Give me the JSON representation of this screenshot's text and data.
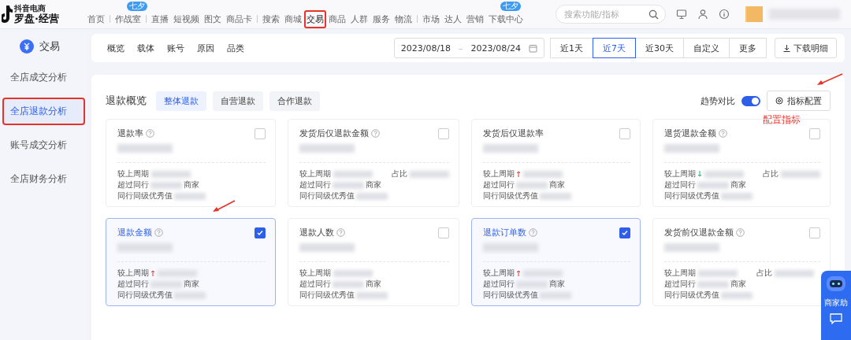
{
  "logo": {
    "small": "抖音电商",
    "main": "罗盘·经营"
  },
  "nav": [
    {
      "label": "首页",
      "selected": false,
      "sep": true
    },
    {
      "label": "作战室",
      "selected": false,
      "sep": true,
      "badge": "七夕"
    },
    {
      "label": "直播",
      "selected": false
    },
    {
      "label": "短视频",
      "selected": false
    },
    {
      "label": "图文",
      "selected": false
    },
    {
      "label": "商品卡",
      "selected": false,
      "sep": true
    },
    {
      "label": "搜索",
      "selected": false
    },
    {
      "label": "商城",
      "selected": false
    },
    {
      "label": "交易",
      "selected": true,
      "annotated": true
    },
    {
      "label": "商品",
      "selected": false
    },
    {
      "label": "人群",
      "selected": false
    },
    {
      "label": "服务",
      "selected": false
    },
    {
      "label": "物流",
      "selected": false,
      "sep": true
    },
    {
      "label": "市场",
      "selected": false
    },
    {
      "label": "达人",
      "selected": false
    },
    {
      "label": "营销",
      "selected": false
    },
    {
      "label": "下载中心",
      "selected": false,
      "badge": "七夕"
    }
  ],
  "search": {
    "placeholder": "搜索功能/指标"
  },
  "sidebar": {
    "title": "交易",
    "items": [
      {
        "label": "全店成交分析",
        "selected": false
      },
      {
        "label": "全店退款分析",
        "selected": true,
        "annotated": true
      },
      {
        "label": "账号成交分析",
        "selected": false
      },
      {
        "label": "全店财务分析",
        "selected": false
      }
    ]
  },
  "filter_tabs": [
    {
      "label": "概览"
    },
    {
      "label": "载体"
    },
    {
      "label": "账号"
    },
    {
      "label": "原因"
    },
    {
      "label": "品类"
    }
  ],
  "date_range": {
    "start": "2023/08/18",
    "separator": "–",
    "end": "2023/08/24"
  },
  "periods": [
    {
      "label": "近1天",
      "selected": false
    },
    {
      "label": "近7天",
      "selected": true
    },
    {
      "label": "近30天",
      "selected": false
    },
    {
      "label": "自定义",
      "selected": false
    },
    {
      "label": "更多",
      "selected": false
    }
  ],
  "download_button": "下载明细",
  "overview": {
    "title": "退款概览",
    "tabs": [
      {
        "label": "整体退款",
        "selected": true
      },
      {
        "label": "自营退款",
        "selected": false
      },
      {
        "label": "合作退款",
        "selected": false
      }
    ],
    "trend_compare": {
      "label": "趋势对比",
      "on": true
    },
    "config_button": "指标配置",
    "annotation": "配置指标"
  },
  "metrics": [
    {
      "name": "退款率",
      "help": true,
      "checked": false,
      "compare": "较上周期",
      "beat": "超过同行",
      "merchants": "商家",
      "peer": "同行同级优秀值"
    },
    {
      "name": "发货后仅退款金额",
      "help": true,
      "checked": false,
      "compare": "较上周期",
      "share": "占比",
      "beat": "超过同行",
      "merchants": "商家",
      "peer": "同行同级优秀值"
    },
    {
      "name": "发货后仅退款率",
      "checked": false,
      "up": true,
      "compare": "较上周期",
      "beat": "超过同行",
      "merchants": "商家",
      "peer": "同行同级优秀值"
    },
    {
      "name": "退货退款金额",
      "help": true,
      "checked": false,
      "down": true,
      "compare": "较上周期",
      "share": "占比",
      "beat": "超过同行",
      "merchants": "商家",
      "peer": "同行同级优秀值"
    },
    {
      "name": "退款金额",
      "help": true,
      "checked": true,
      "up": true,
      "compare": "较上周期",
      "beat": "超过同行",
      "merchants": "商家",
      "peer": "同行同级优秀值"
    },
    {
      "name": "退款人数",
      "help": true,
      "checked": false,
      "compare": "较上周期",
      "beat": "超过同行",
      "merchants": "商家",
      "peer": "同行同级优秀值"
    },
    {
      "name": "退款订单数",
      "help": true,
      "checked": true,
      "up": true,
      "compare": "较上周期",
      "beat": "超过同行",
      "merchants": "商家",
      "peer": "同行同级优秀值"
    },
    {
      "name": "发货前仅退款金额",
      "help": true,
      "checked": false,
      "compare": "较上周期",
      "share": "占比",
      "beat": "超过同行",
      "merchants": "商家",
      "peer": "同行同级优秀值"
    }
  ],
  "assistant": {
    "label": "商家助"
  }
}
